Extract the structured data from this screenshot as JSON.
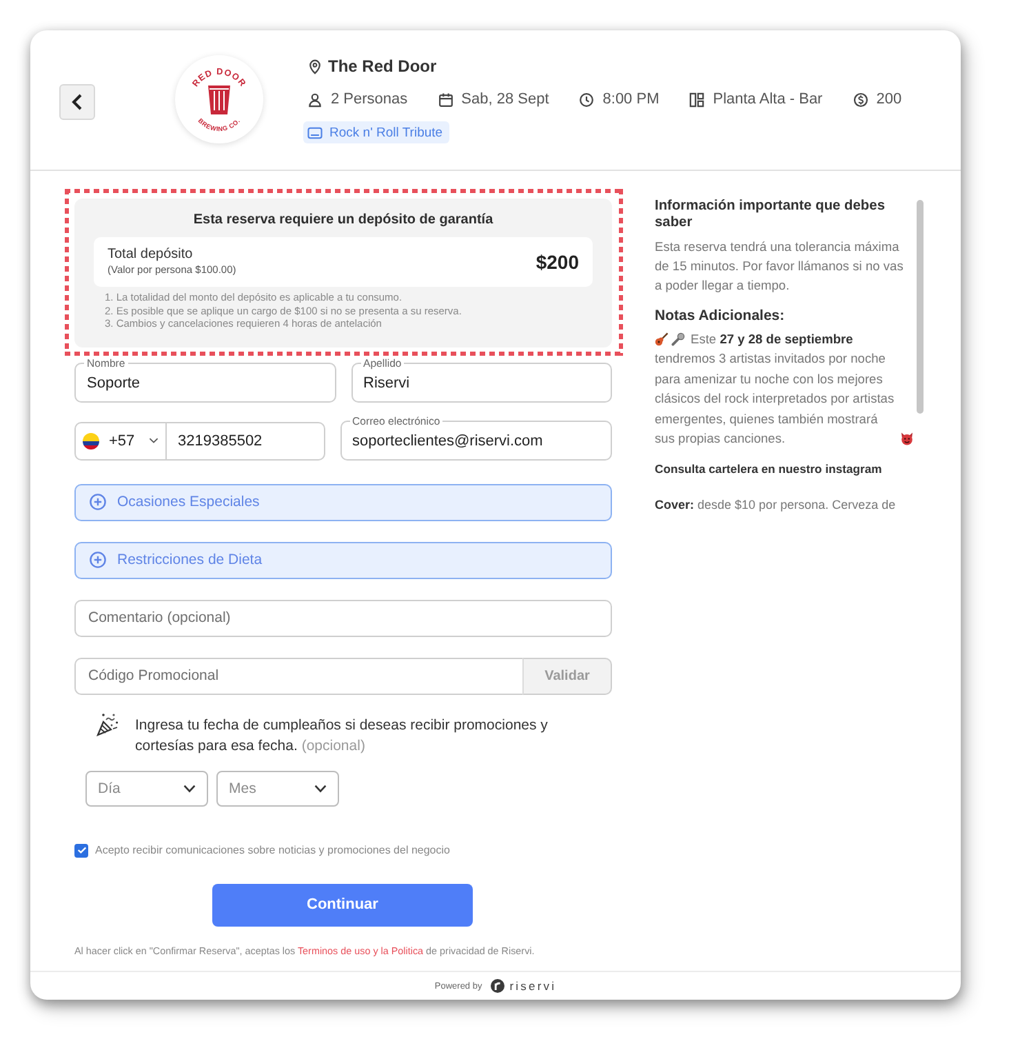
{
  "venue": {
    "name": "The Red Door",
    "logo": {
      "top_text": "RED DOOR",
      "bottom_text": "BREWING CO."
    },
    "details": [
      {
        "kind": "guests",
        "text": "2 Personas"
      },
      {
        "kind": "date",
        "text": "Sab, 28 Sept"
      },
      {
        "kind": "time",
        "text": "8:00 PM"
      },
      {
        "kind": "area",
        "text": "Planta Alta - Bar"
      },
      {
        "kind": "price",
        "text": "200"
      }
    ],
    "event_tag": "Rock n' Roll Tribute"
  },
  "deposit": {
    "highlighted": true,
    "title": "Esta reserva requiere un depósito de garantía",
    "total_label": "Total depósito",
    "per_person": "(Valor por persona $100.00)",
    "amount": "$200",
    "notes": [
      "1. La totalidad del monto del depósito es aplicable a tu consumo.",
      "2. Es posible que se aplique un cargo de $100 si no se presenta a su reserva.",
      "3. Cambios y cancelaciones requieren 4 horas de antelación"
    ]
  },
  "form": {
    "name_fields": [
      {
        "label": "Nombre",
        "value": "Soporte"
      },
      {
        "label": "Apellido",
        "value": "Riservi"
      }
    ],
    "phone": {
      "country_code": "+57",
      "value": "3219385502"
    },
    "email": {
      "label": "Correo electrónico",
      "value": "soporteclientes@riservi.com"
    },
    "expanders": [
      {
        "label": "Ocasiones Especiales",
        "expanded": false
      },
      {
        "label": "Restricciones de Dieta",
        "expanded": false
      }
    ],
    "comment": {
      "placeholder": "Comentario (opcional)"
    },
    "promo": {
      "placeholder": "Código Promocional",
      "button": {
        "label": "Validar",
        "disabled": true
      }
    },
    "birthday": {
      "prompt": "Ingresa tu fecha de cumpleaños si deseas recibir promociones y cortesías para esa fecha.",
      "optional": "(opcional)",
      "selects": [
        {
          "placeholder": "Día"
        },
        {
          "placeholder": "Mes"
        }
      ]
    },
    "consent": {
      "text": "Acepto recibir comunicaciones sobre noticias y promociones del negocio",
      "checked": true
    },
    "submit": "Continuar",
    "legal": {
      "before": "Al hacer click en \"Confirmar Reserva\", aceptas los",
      "link": "Terminos de uso y la Politica",
      "after": "de privacidad de Riservi."
    }
  },
  "side_info": {
    "title": "Información importante que debes saber",
    "text": "Esta reserva tendrá una tolerancia máxima de 15 minutos. Por favor llámanos si no vas a poder llegar a tiempo.",
    "notes_title": "Notas Adicionales:",
    "notes_intro": "Este **27 y 28 de septiembre**",
    "notes_text": "tendremos 3 artistas invitados por noche para amenizar tu noche con los mejores clásicos del rock interpretados por artistas emergentes, quienes también mostrará sus propias canciones.",
    "cta": "Consulta cartelera en nuestro instagram",
    "cover_text": "**Cover:** desde $10 por persona. Cerveza de"
  },
  "footer": {
    "powered_by": "Powered by",
    "brand": "riservi"
  }
}
